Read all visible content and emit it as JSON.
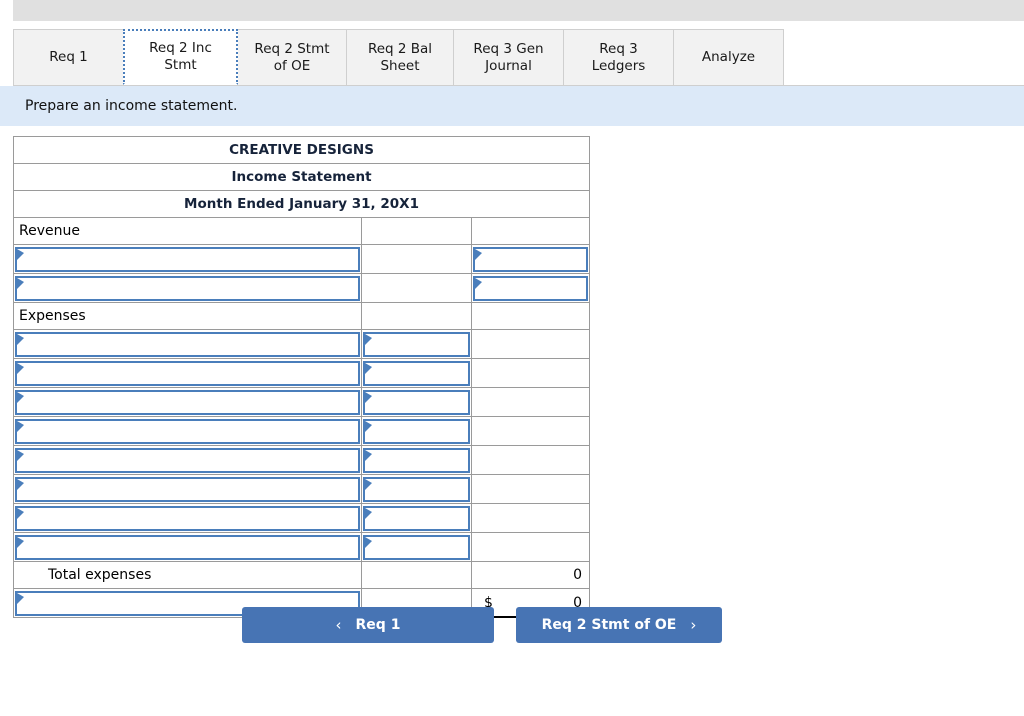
{
  "tabs": [
    {
      "label": "Req 1",
      "active": false,
      "width": 111
    },
    {
      "label": "Req 2 Inc Stmt",
      "active": true,
      "width": 115
    },
    {
      "label": "Req 2 Stmt of OE",
      "active": false,
      "width": 110
    },
    {
      "label": "Req 2 Bal Sheet",
      "active": false,
      "width": 108
    },
    {
      "label": "Req 3 Gen Journal",
      "active": false,
      "width": 111
    },
    {
      "label": "Req 3 Ledgers",
      "active": false,
      "width": 111
    },
    {
      "label": "Analyze",
      "active": false,
      "width": 111
    }
  ],
  "instruction": "Prepare an income statement.",
  "statement": {
    "company": "CREATIVE DESIGNS",
    "title": "Income Statement",
    "period": "Month Ended January 31, 20X1",
    "revenue_label": "Revenue",
    "expenses_label": "Expenses",
    "total_expenses_label": "Total expenses",
    "total_expenses_value": "0",
    "net_dollar_sign": "$",
    "net_value": "0",
    "revenue_input_rows": 2,
    "expense_input_rows": 8
  },
  "nav": {
    "prev_label": "Req 1",
    "prev_chevron": "‹",
    "next_label": "Req 2 Stmt of OE",
    "next_chevron": "›"
  },
  "colors": {
    "header_blue": "#84aede",
    "banner_blue": "#dce9f8",
    "button_blue": "#4774b4",
    "field_border": "#4a7ebb"
  }
}
